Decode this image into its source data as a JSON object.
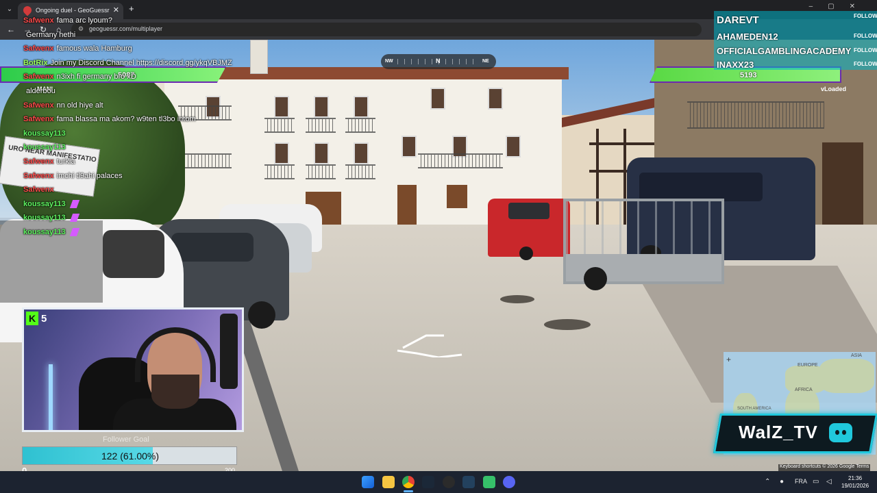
{
  "browser": {
    "tab_title": "Ongoing duel - GeoGuessr",
    "url": "geoguessr.com/multiplayer",
    "new_tab": "+",
    "tab_close": "✕"
  },
  "compass": {
    "nw": "NW",
    "n": "N",
    "ne": "NE"
  },
  "players": {
    "left": {
      "score": "5087",
      "name": "MANI",
      "health_fraction": 1.0
    },
    "right": {
      "score": "5193",
      "name": "vLoaded",
      "health_fraction": 1.0
    }
  },
  "chat": [
    {
      "user": "Safwenx",
      "msg": "fama arc lyoum?",
      "user_color": "red"
    },
    {
      "user": "",
      "msg": "Germany hethi",
      "user_color": "red"
    },
    {
      "user": "Safwenx",
      "msg": "famous wala Hamburg",
      "user_color": "red"
    },
    {
      "user": "BotRix",
      "msg": "Join my Discord Channel https://discord.gg/ykqVBJMZ",
      "user_color": "lime"
    },
    {
      "user": "Safwenx",
      "msg": "n3ixh fi germany bro xD",
      "user_color": "red"
    },
    {
      "user": "",
      "msg": "alderbou",
      "user_color": "red"
    },
    {
      "user": "Safwenx",
      "msg": "nn old hiye alt",
      "user_color": "red"
    },
    {
      "user": "Safwenx",
      "msg": "fama blassa ma akom? w9ten tl3bo intom",
      "user_color": "red"
    },
    {
      "user": "koussay113",
      "msg": "",
      "user_color": "green"
    },
    {
      "user": "koussay113",
      "msg": "",
      "user_color": "green"
    },
    {
      "user": "Safwenx",
      "msg": "turkia",
      "user_color": "red"
    },
    {
      "user": "Safwenx",
      "msg": "imchi tl9ahi palaces",
      "user_color": "red"
    },
    {
      "user": "Safwenx",
      "msg": "",
      "user_color": "red"
    },
    {
      "user": "koussay113",
      "msg": "",
      "user_color": "green"
    },
    {
      "user": "koussay113",
      "msg": "",
      "user_color": "green"
    },
    {
      "user": "koussay113",
      "msg": "",
      "user_color": "green"
    }
  ],
  "followers": [
    {
      "name": "DAREVT",
      "action": "FOLLOW"
    },
    {
      "name": "AHAMEDEN12",
      "action": "FOLLOW"
    },
    {
      "name": "OFFICIALGAMBLINGACADEMY",
      "action": "FOLLOW"
    },
    {
      "name": "INAXX23",
      "action": "FOLLOW"
    }
  ],
  "kick": {
    "logo": "K",
    "viewers": "5"
  },
  "follower_goal": {
    "label": "Follower Goal",
    "progress_text": "122 (61.00%)",
    "fraction": 0.61,
    "min": "0",
    "max": "200"
  },
  "minimap": {
    "europe": "EUROPE",
    "asia": "ASIA",
    "africa": "AFRICA",
    "south_america": "SOUTH AMERICA",
    "zoom_in": "+"
  },
  "brand": {
    "name": "WalZ_TV"
  },
  "map_footer": "Keyboard shortcuts  © 2026 Google  Terms",
  "taskbar": {
    "lang": "FRA",
    "time": "21:36",
    "date": "19/01/2026"
  },
  "scene_banner": "URO NEAR MANIFESTATIO",
  "colors": {
    "accent": "#20c8dc",
    "health": "#5ef560",
    "kick_green": "#53fc18"
  }
}
